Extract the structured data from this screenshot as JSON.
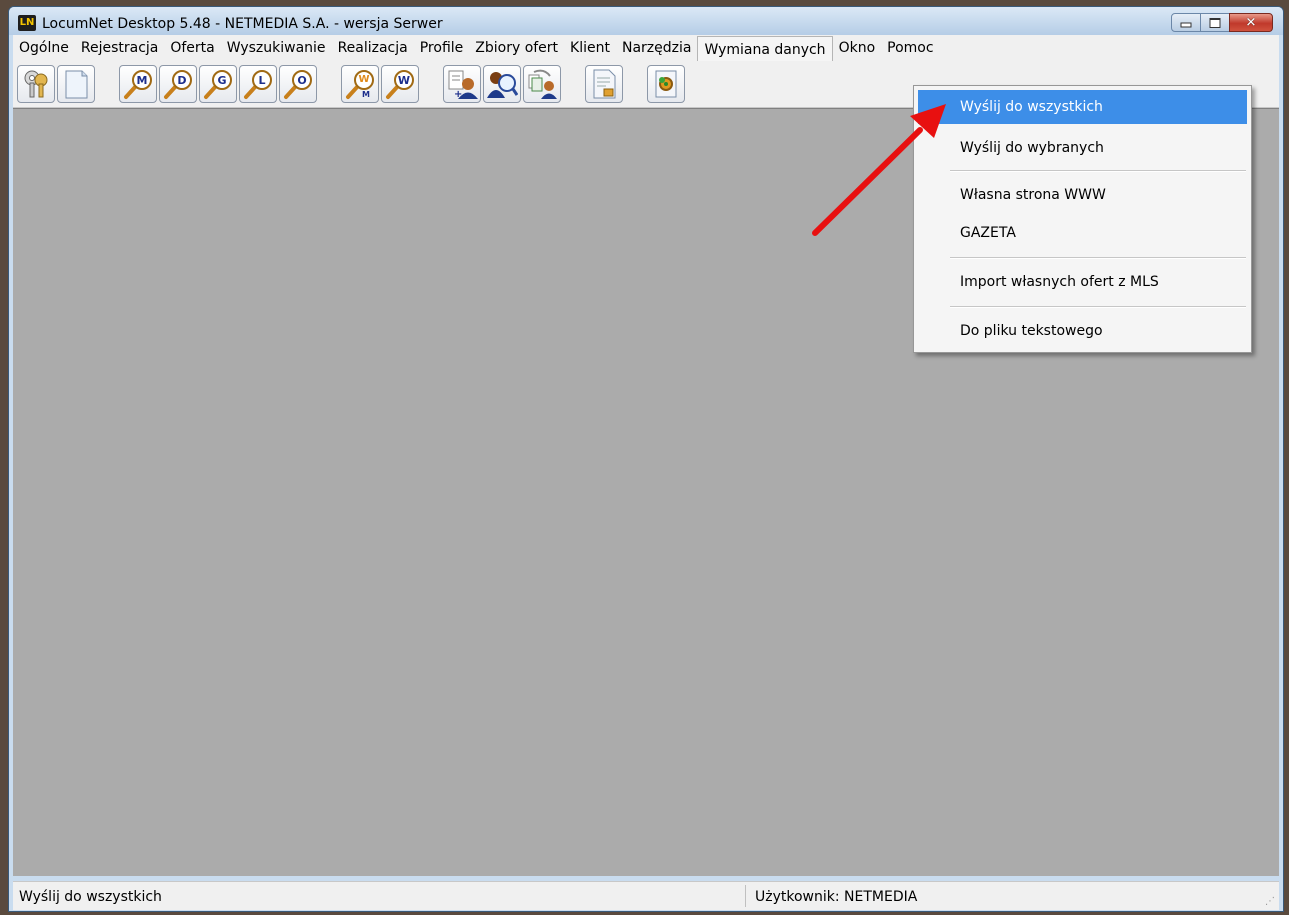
{
  "window": {
    "title": "LocumNet Desktop 5.48 - NETMEDIA S.A. - wersja Serwer",
    "app_icon_text": "LN",
    "buttons": {
      "minimize": "minimize-icon",
      "maximize": "maximize-icon",
      "close": "✕"
    }
  },
  "menubar": {
    "items": [
      "Ogólne",
      "Rejestracja",
      "Oferta",
      "Wyszukiwanie",
      "Realizacja",
      "Profile",
      "Zbiory ofert",
      "Klient",
      "Narzędzia",
      "Wymiana danych",
      "Okno",
      "Pomoc"
    ],
    "open_item": "Wymiana danych"
  },
  "toolbar": {
    "buttons": [
      {
        "icon": "keys-icon"
      },
      {
        "icon": "blank-document-icon"
      },
      {
        "icon": "search-m-icon",
        "letter": "M"
      },
      {
        "icon": "search-d-icon",
        "letter": "D"
      },
      {
        "icon": "search-g-icon",
        "letter": "G"
      },
      {
        "icon": "search-l-icon",
        "letter": "L"
      },
      {
        "icon": "search-o-icon",
        "letter": "O"
      },
      {
        "icon": "search-wm-icon",
        "letter": "W",
        "subletter": "M"
      },
      {
        "icon": "search-w-icon",
        "letter": "W"
      },
      {
        "icon": "add-client-icon"
      },
      {
        "icon": "client-search-icon"
      },
      {
        "icon": "client-copy-icon"
      },
      {
        "icon": "report-document-icon"
      },
      {
        "icon": "settings-gear-icon"
      }
    ]
  },
  "dropdown": {
    "items": [
      "Wyślij do wszystkich",
      "Wyślij do wybranych",
      "Własna strona WWW",
      "GAZETA",
      "Import własnych ofert z MLS",
      "Do pliku tekstowego"
    ],
    "highlighted": "Wyślij do wszystkich"
  },
  "statusbar": {
    "left": "Wyślij do wszystkich",
    "right": "Użytkownik: NETMEDIA"
  },
  "colors": {
    "highlight": "#3d8ee8",
    "workspace": "#ababab",
    "annotation_arrow": "#e81010"
  }
}
